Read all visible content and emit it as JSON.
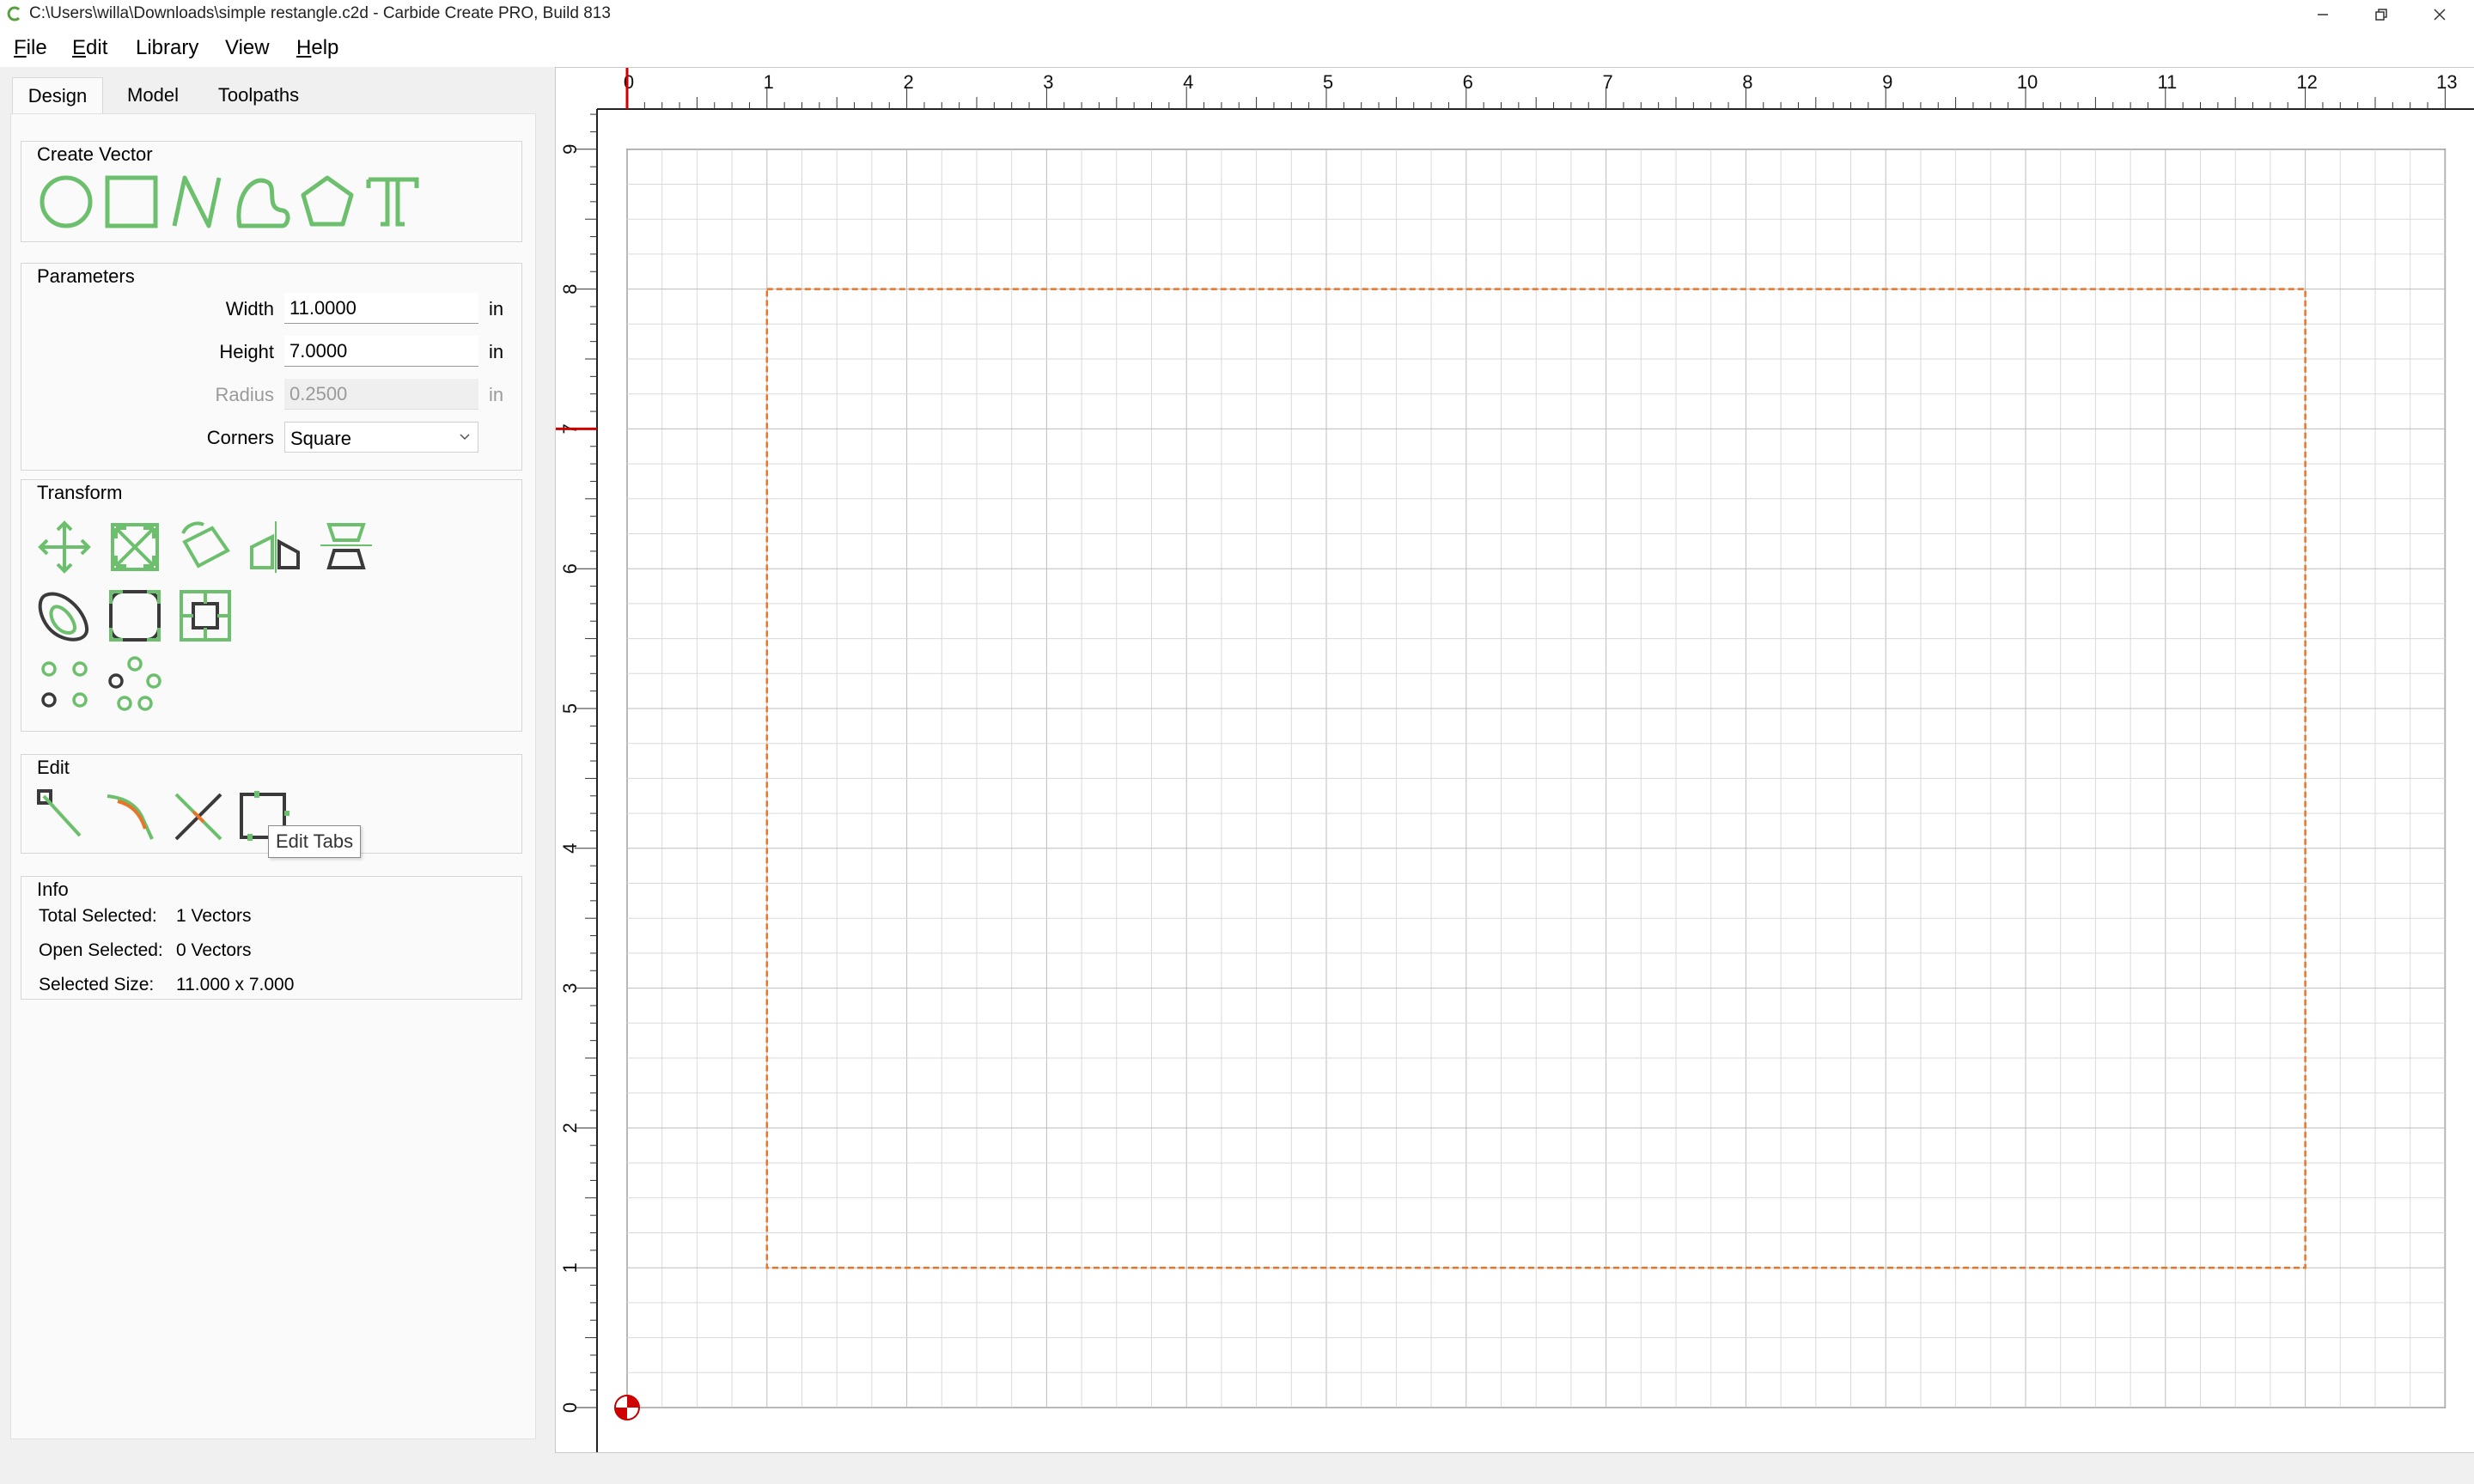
{
  "window": {
    "title": "C:\\Users\\willa\\Downloads\\simple restangle.c2d - Carbide Create PRO, Build 813",
    "controls": [
      "minimize",
      "restore",
      "close"
    ]
  },
  "menu": [
    {
      "accel": "F",
      "rest": "ile"
    },
    {
      "accel": "E",
      "rest": "dit"
    },
    {
      "accel": "",
      "rest": "Library"
    },
    {
      "accel": "",
      "rest": "View"
    },
    {
      "accel": "H",
      "rest": "elp"
    }
  ],
  "tabs": {
    "design": "Design",
    "model": "Model",
    "toolpaths": "Toolpaths",
    "active": "Design"
  },
  "create_vector": {
    "title": "Create Vector",
    "tools": [
      "circle-icon",
      "rectangle-icon",
      "polyline-icon",
      "curve-icon",
      "polygon-icon",
      "text-icon"
    ]
  },
  "parameters": {
    "title": "Parameters",
    "width": {
      "label": "Width",
      "value": "11.0000",
      "unit": "in"
    },
    "height": {
      "label": "Height",
      "value": "7.0000",
      "unit": "in"
    },
    "radius": {
      "label": "Radius",
      "value": "0.2500",
      "unit": "in"
    },
    "corners": {
      "label": "Corners",
      "value": "Square"
    }
  },
  "transform": {
    "title": "Transform",
    "tools": [
      "move-icon",
      "scale-icon",
      "rotate-icon",
      "mirror-icon",
      "align-icon",
      "offset-icon",
      "fillet-icon",
      "boolean-icon",
      "array-icon",
      "circular-array-icon"
    ]
  },
  "edit": {
    "title": "Edit",
    "tools": [
      "node-edit-icon",
      "trim-icon",
      "cut-icon",
      "edit-tabs-icon"
    ],
    "tooltip": "Edit Tabs"
  },
  "info": {
    "title": "Info",
    "total_selected_label": "Total Selected:",
    "total_selected_value": "1 Vectors",
    "open_selected_label": "Open Selected:",
    "open_selected_value": "0 Vectors",
    "selected_size_label": "Selected Size:",
    "selected_size_value": "11.000 x 7.000"
  },
  "canvas": {
    "units": "in",
    "x_range": [
      0,
      13
    ],
    "y_range": [
      0,
      9
    ],
    "x_ticks": [
      "0",
      "1",
      "2",
      "3",
      "4",
      "5",
      "6",
      "7",
      "8",
      "9",
      "10",
      "11",
      "12",
      "13"
    ],
    "y_ticks": [
      "0",
      "1",
      "2",
      "3",
      "4",
      "5",
      "6",
      "7",
      "8",
      "9"
    ],
    "stock": {
      "width": 13,
      "height": 9
    },
    "selected_rect": {
      "x0": 1,
      "y0": 1,
      "x1": 12,
      "y1": 8
    },
    "cursor_y": 7,
    "colors": {
      "selection": "#e8752a",
      "grid": "#d0d0d0",
      "ruler_marker": "#d00000",
      "tool_green": "#6cbf6c",
      "tool_dark": "#3a3a3a"
    }
  }
}
